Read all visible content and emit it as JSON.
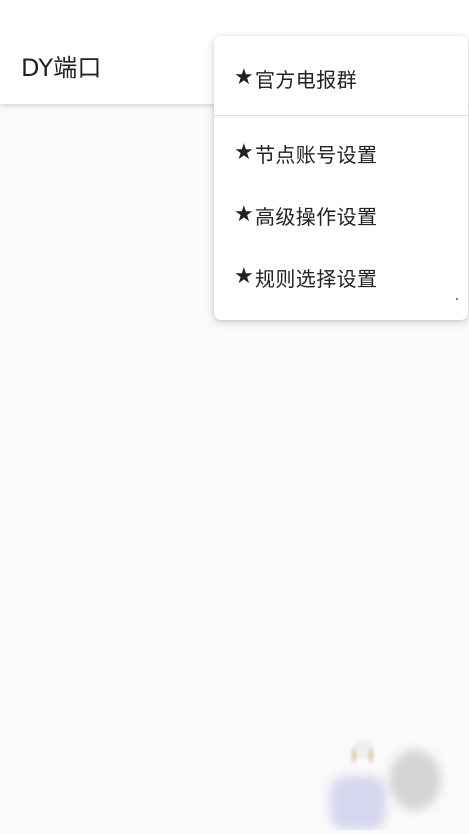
{
  "toolbar": {
    "title": "DY端口"
  },
  "menu": {
    "items": [
      {
        "star": "★",
        "label": "官方电报群"
      },
      {
        "star": "★",
        "label": "节点账号设置"
      },
      {
        "star": "★",
        "label": "高级操作设置"
      },
      {
        "star": "★",
        "label": "规则选择设置"
      }
    ]
  },
  "icons": {
    "floating": "floating-assistant-icon"
  },
  "colors": {
    "toolbar_background": "#ffffff",
    "page_background": "#fafafa",
    "menu_background": "#ffffff",
    "text": "#222222",
    "divider": "#dddddd"
  }
}
